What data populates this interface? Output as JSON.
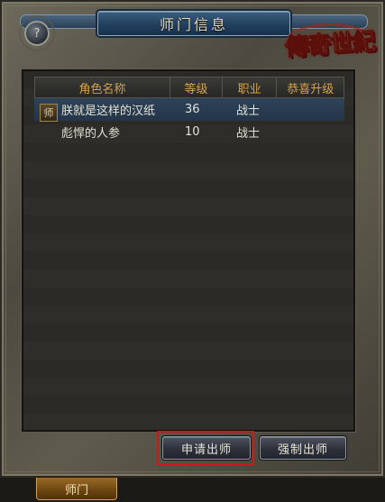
{
  "window": {
    "title": "师门信息",
    "help_icon": "?",
    "logo_text": "傳奇世紀"
  },
  "table": {
    "columns": [
      "角色名称",
      "等级",
      "职业",
      "恭喜升级"
    ],
    "rows": [
      {
        "badge": "师",
        "name": "朕就是这样的汉纸",
        "level": "36",
        "job": "战士",
        "congrats": "",
        "selected": true
      },
      {
        "badge": "",
        "name": "彪悍的人参",
        "level": "10",
        "job": "战士",
        "congrats": "",
        "selected": false
      }
    ]
  },
  "buttons": {
    "apply": "申请出师",
    "force": "强制出师"
  },
  "tabs": {
    "active": "师门"
  },
  "colors": {
    "header_text": "#d4a24a",
    "title_banner": "#21405e",
    "highlight_border": "#c81b1b",
    "tab": "#6b4510"
  }
}
